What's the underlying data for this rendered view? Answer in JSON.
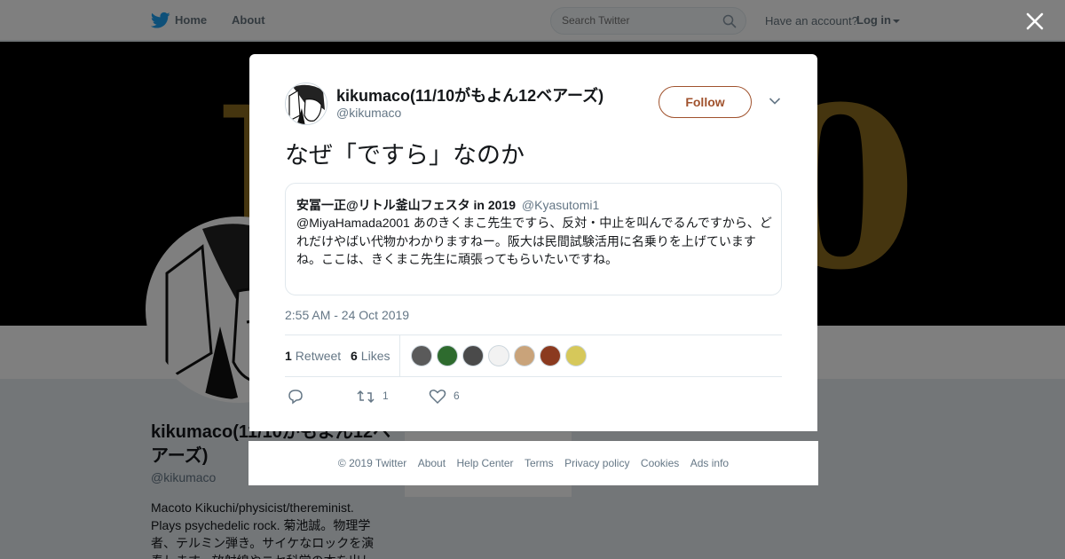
{
  "nav": {
    "home_label": "Home",
    "about_label": "About",
    "search_placeholder": "Search Twitter",
    "have_account": "Have an account?",
    "login_label": "Log in"
  },
  "profile": {
    "name": "kikumaco(11/10がもよん12ベアーズ)",
    "handle": "@kikumaco",
    "bio": "Macoto Kikuchi/physicist/thereminist. Plays psychedelic rock. 菊池誠。物理学者、テルミン弾き。サイケなロックを演奏します。放射線やニセ科学の本を出し"
  },
  "tweet": {
    "author_name": "kikumaco(11/10がもよん12ベアーズ)",
    "author_handle": "@kikumaco",
    "follow_label": "Follow",
    "text": "なぜ「ですら」なのか",
    "quote": {
      "name": "安冨一正@リトル釜山フェスタ in 2019",
      "handle": "@Kyasutomi1",
      "text": "@MiyaHamada2001 あのきくまこ先生ですら、反対・中止を叫んでるんですから、どれだけやばい代物かわかりますねー。阪大は民間試験活用に名乗りを上げていますね。ここは、きくまこ先生に頑張ってもらいたいですね。"
    },
    "timestamp": "2:55 AM - 24 Oct 2019",
    "stats": {
      "retweets_count": "1",
      "retweets_label": "Retweet",
      "likes_count": "6",
      "likes_label": "Likes"
    },
    "likers": [
      {
        "name": "liker-1",
        "color": "#5a5a5a"
      },
      {
        "name": "liker-2",
        "color": "#2e6b2e"
      },
      {
        "name": "liker-3",
        "color": "#4a4a4a"
      },
      {
        "name": "liker-4",
        "color": "#f2f2f2"
      },
      {
        "name": "liker-5",
        "color": "#c9a37a"
      },
      {
        "name": "liker-6",
        "color": "#8b3a1f"
      },
      {
        "name": "liker-7",
        "color": "#d6c85a"
      }
    ],
    "actions": {
      "retweet_count": "1",
      "like_count": "6"
    }
  },
  "footer": {
    "links": [
      "© 2019 Twitter",
      "About",
      "Help Center",
      "Terms",
      "Privacy policy",
      "Cookies",
      "Ads info"
    ]
  },
  "colors": {
    "accent": "#a0522d",
    "twitter_blue": "#1da1f2",
    "muted": "#657786"
  }
}
